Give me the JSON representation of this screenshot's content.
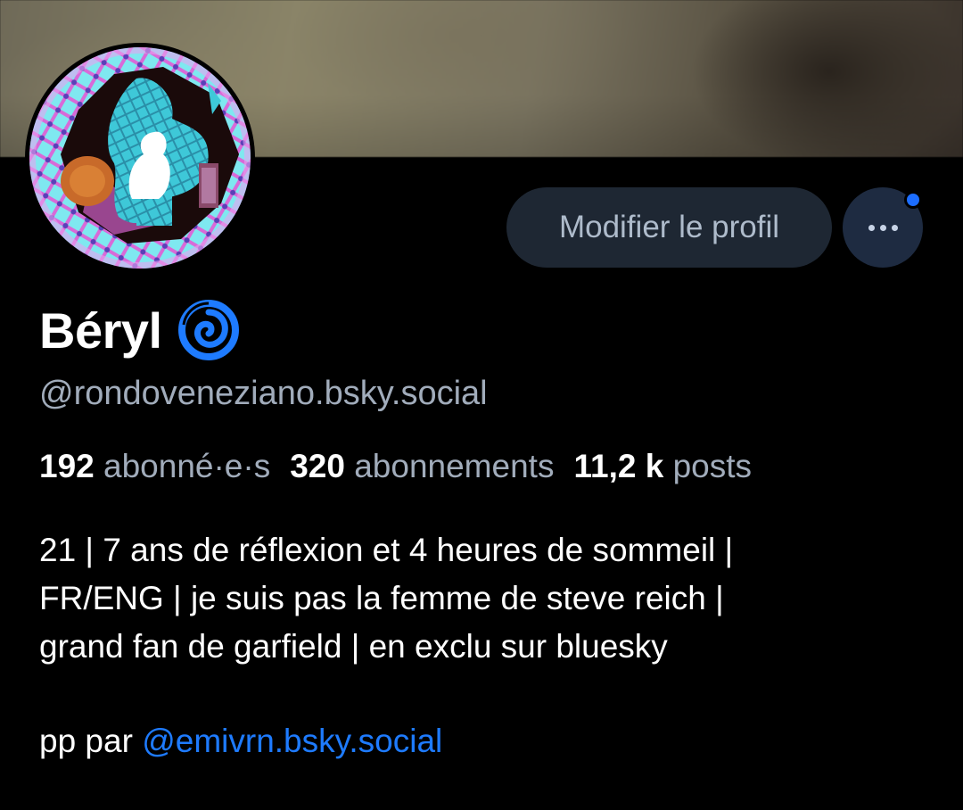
{
  "profile": {
    "display_name": "Béryl",
    "name_icon": "spiral-icon",
    "handle": "@rondoveneziano.bsky.social"
  },
  "actions": {
    "edit_label": "Modifier le profil",
    "more_icon": "more-dots-icon"
  },
  "stats": {
    "followers_count": "192",
    "followers_label": "abonné·e·s",
    "following_count": "320",
    "following_label": "abonnements",
    "posts_count": "11,2 k",
    "posts_label": "posts"
  },
  "bio": {
    "lines": [
      "21 | 7 ans de réflexion et 4 heures de sommeil |",
      "FR/ENG | je suis pas la femme de steve reich |",
      "grand fan de garfield | en exclu sur bluesky"
    ],
    "credit_prefix": "pp par ",
    "credit_mention": "@emivrn.bsky.social"
  },
  "colors": {
    "background": "#000000",
    "accent": "#1e7bff",
    "muted_text": "#a1acbb",
    "button_bg": "#1e2733"
  }
}
